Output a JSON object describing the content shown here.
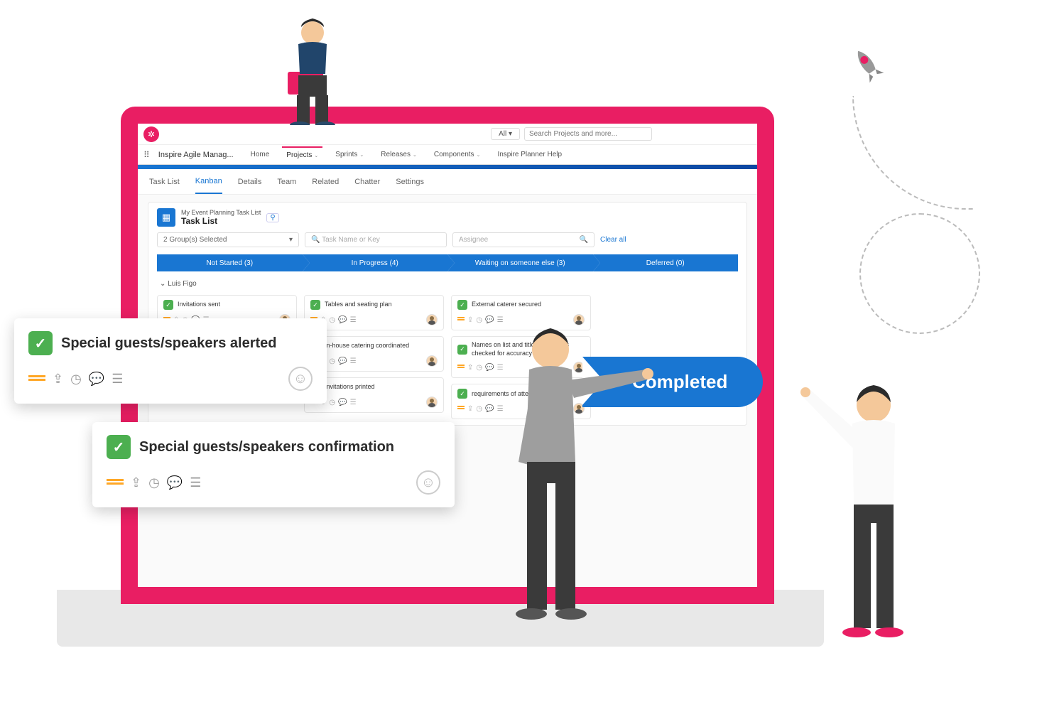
{
  "search": {
    "all_label": "All ▾",
    "placeholder": "Search Projects and more..."
  },
  "app_name": "Inspire Agile Manag...",
  "nav": [
    {
      "label": "Home"
    },
    {
      "label": "Projects",
      "active": true
    },
    {
      "label": "Sprints"
    },
    {
      "label": "Releases"
    },
    {
      "label": "Components"
    },
    {
      "label": "Inspire Planner Help"
    }
  ],
  "tabs": [
    {
      "label": "Task List"
    },
    {
      "label": "Kanban",
      "active": true
    },
    {
      "label": "Details"
    },
    {
      "label": "Team"
    },
    {
      "label": "Related"
    },
    {
      "label": "Chatter"
    },
    {
      "label": "Settings"
    }
  ],
  "page": {
    "subtitle": "My Event Planning Task List",
    "title": "Task List"
  },
  "filters": {
    "groups": "2 Group(s) Selected",
    "task_placeholder": "Task Name or Key",
    "assignee_placeholder": "Assignee",
    "clear": "Clear all"
  },
  "statuses": [
    {
      "label": "Not Started  (3)"
    },
    {
      "label": "In Progress  (4)"
    },
    {
      "label": "Waiting on someone else  (3)"
    },
    {
      "label": "Deferred  (0)"
    }
  ],
  "group_name": "Luis Figo",
  "columns": [
    {
      "cards": [
        {
          "title": "Invitations sent"
        },
        {
          "title": "Special guests/speakers alerted"
        }
      ]
    },
    {
      "cards": [
        {
          "title": "Tables and seating plan"
        },
        {
          "title": "In-house catering coordinated"
        },
        {
          "title": "Invitations printed"
        }
      ]
    },
    {
      "cards": [
        {
          "title": "External caterer secured"
        },
        {
          "title": "Names on list and titles/addresses checked for accuracy"
        },
        {
          "title": "requirements of attendees"
        }
      ]
    },
    {
      "cards": []
    }
  ],
  "float1": "Special guests/speakers alerted",
  "float2": "Special guests/speakers confirmation",
  "completed_label": "Completed"
}
